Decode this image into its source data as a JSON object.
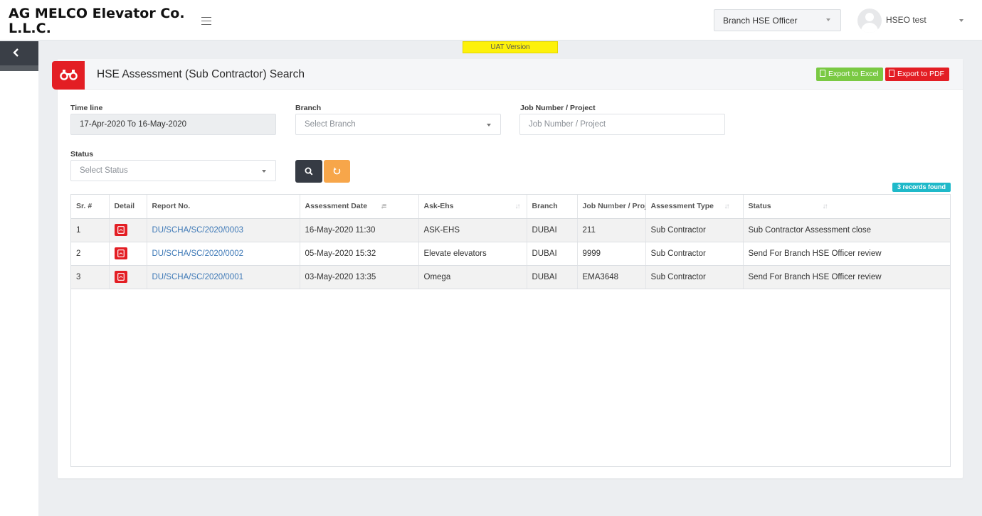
{
  "header": {
    "brand_line1": "AG MELCO Elevator Co.",
    "brand_line2": "L.L.C.",
    "role_selected": "Branch HSE Officer",
    "username": "HSEO test"
  },
  "banner": {
    "uat_label": "UAT Version"
  },
  "page": {
    "title": "HSE Assessment (Sub Contractor) Search",
    "export_excel": "Export to Excel",
    "export_pdf": "Export to PDF"
  },
  "filters": {
    "timeline_label": "Time line",
    "timeline_value": "17-Apr-2020 To 16-May-2020",
    "branch_label": "Branch",
    "branch_placeholder": "Select Branch",
    "job_label": "Job Number / Project",
    "job_placeholder": "Job Number / Project",
    "status_label": "Status",
    "status_placeholder": "Select Status"
  },
  "records_found": "3 records found",
  "table": {
    "columns": [
      "Sr. #",
      "Detail",
      "Report No.",
      "Assessment Date",
      "Ask-Ehs",
      "Branch",
      "Job Number / Project",
      "Assessment Type",
      "Status"
    ],
    "rows": [
      {
        "sr": "1",
        "report": "DU/SCHA/SC/2020/0003",
        "date": "16-May-2020 11:30",
        "ask": "ASK-EHS",
        "branch": "DUBAI",
        "job": "211",
        "type": "Sub Contractor",
        "status": "Sub Contractor Assessment close"
      },
      {
        "sr": "2",
        "report": "DU/SCHA/SC/2020/0002",
        "date": "05-May-2020 15:32",
        "ask": "Elevate elevators",
        "branch": "DUBAI",
        "job": "9999",
        "type": "Sub Contractor",
        "status": "Send For Branch HSE Officer review"
      },
      {
        "sr": "3",
        "report": "DU/SCHA/SC/2020/0001",
        "date": "03-May-2020 13:35",
        "ask": "Omega",
        "branch": "DUBAI",
        "job": "EMA3648",
        "type": "Sub Contractor",
        "status": "Send For Branch HSE Officer review"
      }
    ]
  },
  "colors": {
    "brand_red": "#e31e24",
    "excel_green": "#7ac943",
    "reset_orange": "#f7a64a",
    "badge_teal": "#1fb9c9",
    "uat_yellow": "#fdf10a"
  },
  "icons": [
    "hamburger-icon",
    "chevron-left-icon",
    "binoculars-icon",
    "search-icon",
    "reset-icon",
    "pdf-icon",
    "avatar-icon"
  ]
}
